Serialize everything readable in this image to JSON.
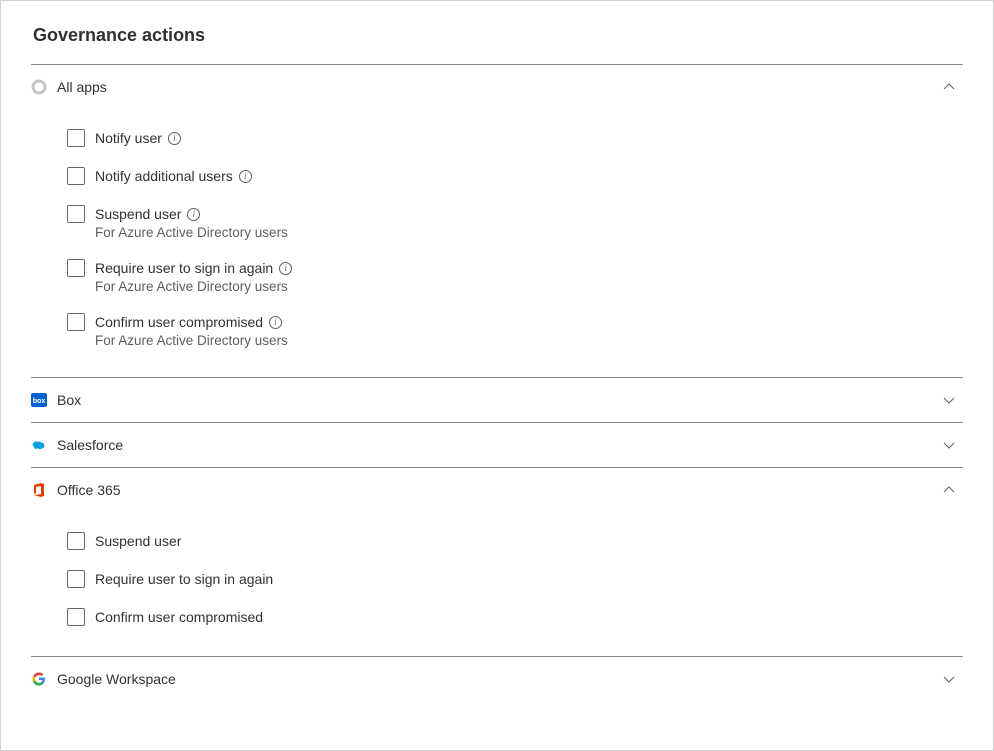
{
  "title": "Governance actions",
  "sections": {
    "all_apps": {
      "label": "All apps",
      "expanded": true,
      "actions": [
        {
          "label": "Notify user",
          "info": true,
          "hint": ""
        },
        {
          "label": "Notify additional users",
          "info": true,
          "hint": ""
        },
        {
          "label": "Suspend user",
          "info": true,
          "hint": "For Azure Active Directory users"
        },
        {
          "label": "Require user to sign in again",
          "info": true,
          "hint": "For Azure Active Directory users"
        },
        {
          "label": "Confirm user compromised",
          "info": true,
          "hint": "For Azure Active Directory users"
        }
      ]
    },
    "box": {
      "label": "Box",
      "expanded": false
    },
    "salesforce": {
      "label": "Salesforce",
      "expanded": false
    },
    "office365": {
      "label": "Office 365",
      "expanded": true,
      "actions": [
        {
          "label": "Suspend user",
          "info": false,
          "hint": ""
        },
        {
          "label": "Require user to sign in again",
          "info": false,
          "hint": ""
        },
        {
          "label": "Confirm user compromised",
          "info": false,
          "hint": ""
        }
      ]
    },
    "google": {
      "label": "Google Workspace",
      "expanded": false
    }
  }
}
